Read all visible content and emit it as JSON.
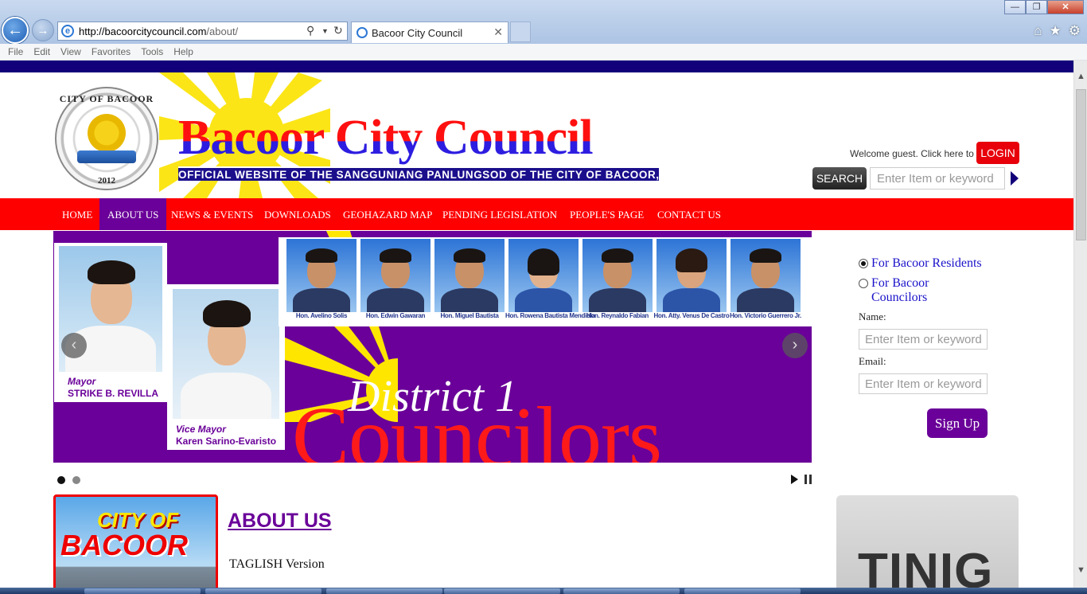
{
  "browser": {
    "url_host": "http://bacoorcitycouncil.com",
    "url_path": "/about/",
    "tab_title": "Bacoor City Council",
    "menu": [
      "File",
      "Edit",
      "View",
      "Favorites",
      "Tools",
      "Help"
    ]
  },
  "header": {
    "seal_top": "CITY OF BACOOR",
    "seal_year": "2012",
    "title": "Bacoor City Council",
    "subtitle": "OFFICIAL WEBSITE OF THE SANGGUNIANG PANLUNGSOD OF THE CITY OF BACOOR, CAVITE",
    "welcome_text": "Welcome guest. Click here to",
    "login_label": "LOGIN",
    "search_label": "SEARCH",
    "search_placeholder": "Enter Item or keyword"
  },
  "nav": {
    "items": [
      "HOME",
      "ABOUT US",
      "NEWS & EVENTS",
      "DOWNLOADS",
      "GEOHAZARD MAP",
      "PENDING LEGISLATION",
      "PEOPLE'S PAGE",
      "CONTACT US"
    ],
    "active": "ABOUT US"
  },
  "slider": {
    "mayor_role": "Mayor",
    "mayor_name": "STRIKE B. REVILLA",
    "vice_role": "Vice Mayor",
    "vice_name": "Karen Sarino-Evaristo",
    "councilors": [
      "Hon. Avelino Solis",
      "Hon. Edwin Gawaran",
      "Hon. Miguel Bautista",
      "Hon. Rowena Bautista Mendiola",
      "Hon. Reynaldo Fabian",
      "Hon. Atty. Venus De Castro",
      "Hon. Victorio Guerrero Jr."
    ],
    "district_text": "District 1",
    "councilors_text": "Councilors",
    "prev": "‹",
    "next": "›"
  },
  "signup": {
    "option_residents": "For Bacoor Residents",
    "option_councilors": "For Bacoor Councilors",
    "name_label": "Name:",
    "email_label": "Email:",
    "placeholder": "Enter Item or keyword",
    "button": "Sign Up"
  },
  "content": {
    "thumb_line1": "CITY OF",
    "thumb_line2": "BACOOR",
    "about_title": "ABOUT US",
    "about_sub": "TAGLISH Version",
    "tinig": "TINIG"
  },
  "colors": {
    "nav_red": "#ff0000",
    "purple": "#6a0099",
    "navy": "#12007a"
  }
}
